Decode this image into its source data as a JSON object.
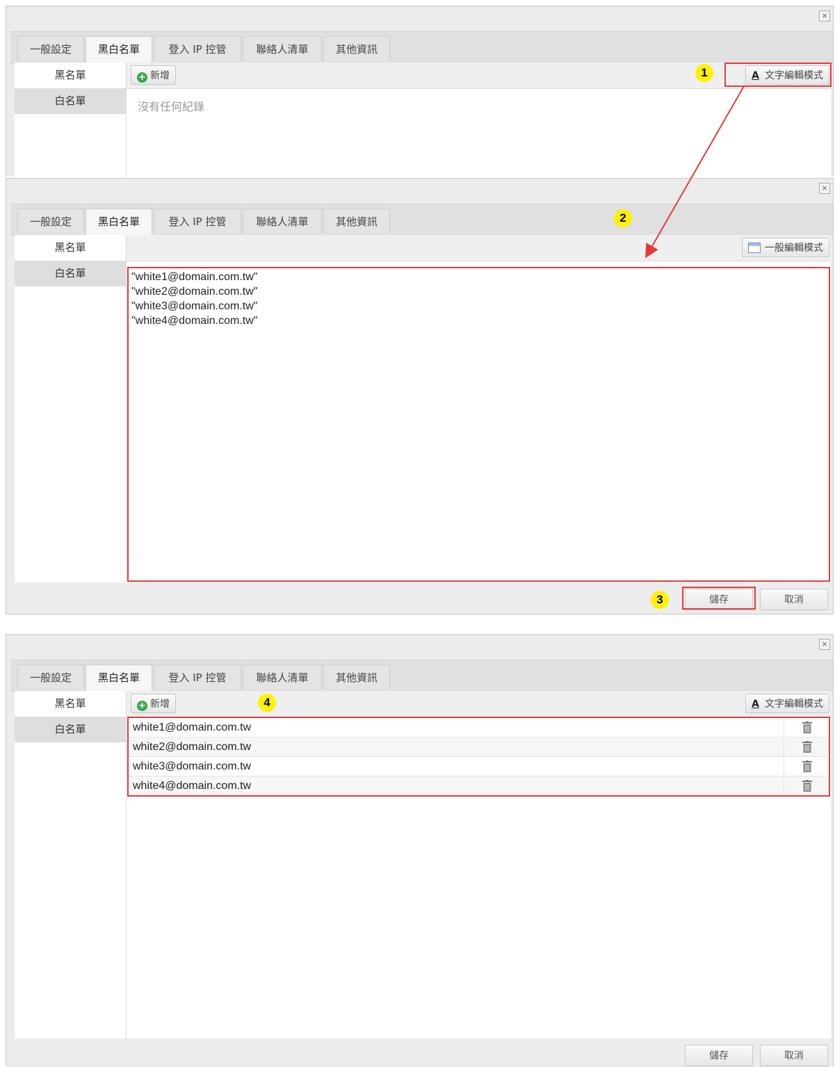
{
  "tabs": [
    "一般設定",
    "黑白名單",
    "登入 IP 控管",
    "聯絡人清單",
    "其他資訊"
  ],
  "sidebar": [
    "黑名單",
    "白名單"
  ],
  "close_label": "×",
  "panel1": {
    "add_button": "新增",
    "text_mode_button": "文字編輯模式",
    "empty_text": "沒有任何紀錄"
  },
  "panel2": {
    "normal_mode_button": "一般編輯模式",
    "textarea_lines": [
      "\"white1@domain.com.tw\"",
      "\"white2@domain.com.tw\"",
      "\"white3@domain.com.tw\"",
      "\"white4@domain.com.tw\""
    ],
    "save_button": "儲存",
    "cancel_button": "取消"
  },
  "panel3": {
    "add_button": "新增",
    "text_mode_button": "文字編輯模式",
    "rows": [
      "white1@domain.com.tw",
      "white2@domain.com.tw",
      "white3@domain.com.tw",
      "white4@domain.com.tw"
    ],
    "save_button": "儲存",
    "cancel_button": "取消"
  },
  "callouts": [
    "1",
    "2",
    "3",
    "4"
  ],
  "colors": {
    "highlight": "#e23b3b",
    "callout": "#fff200",
    "add_icon": "#3aa64b"
  },
  "icons": [
    "close-icon",
    "add-icon",
    "text-mode-icon",
    "table-icon",
    "trash-icon"
  ]
}
